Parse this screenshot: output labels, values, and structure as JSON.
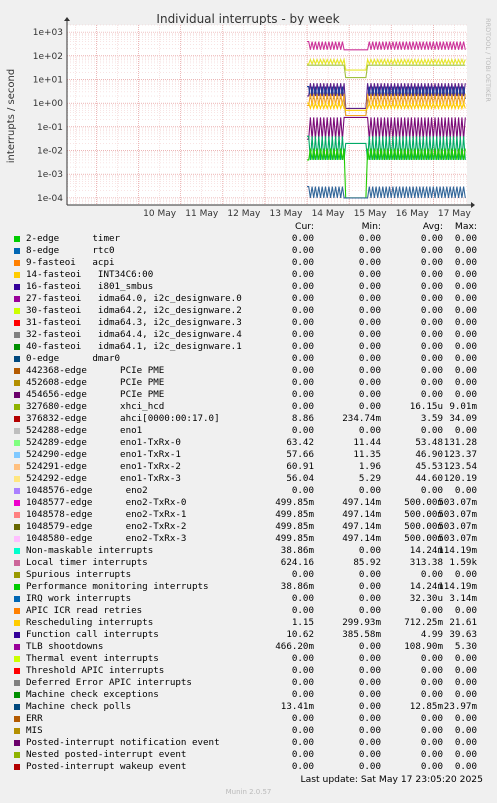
{
  "chart_data": {
    "type": "line",
    "title": "Individual interrupts - by week",
    "ylabel": "interrupts / second",
    "side_label": "RRDTOOL / TOBI OETIKER",
    "yscale": "log",
    "ylim": [
      5e-05,
      2000
    ],
    "y_ticks": [
      {
        "v": 1000,
        "label": "1e+03"
      },
      {
        "v": 100,
        "label": "1e+02"
      },
      {
        "v": 10,
        "label": "1e+01"
      },
      {
        "v": 1,
        "label": "1e+00"
      },
      {
        "v": 0.1,
        "label": "1e-01"
      },
      {
        "v": 0.01,
        "label": "1e-02"
      },
      {
        "v": 0.001,
        "label": "1e-03"
      },
      {
        "v": 0.0001,
        "label": "1e-04"
      }
    ],
    "x_ticks": [
      "10 May",
      "11 May",
      "12 May",
      "13 May",
      "14 May",
      "15 May",
      "16 May",
      "17 May"
    ],
    "x_range_days": [
      8.3,
      17.8
    ],
    "data_start_day": 14.0,
    "gap": [
      14.9,
      15.4
    ],
    "series_levels": [
      {
        "color": "#cc3399",
        "high": 400,
        "low": 180,
        "gap": 180
      },
      {
        "color": "#e6e62a",
        "high": 70,
        "low": 45,
        "gap": 25
      },
      {
        "color": "#a0c040",
        "high": 40,
        "low": 40,
        "gap": 12
      },
      {
        "color": "#5c1f8a",
        "high": 7,
        "low": 2,
        "gap": 0.6
      },
      {
        "color": "#1a3d99",
        "high": 5,
        "low": 1.5,
        "gap": 0.3
      },
      {
        "color": "#f5a623",
        "high": 2.5,
        "low": 0.8,
        "gap": 0.3
      },
      {
        "color": "#ffcc00",
        "high": 1.0,
        "low": 0.6,
        "gap": 0.5
      },
      {
        "color": "#7a0a78",
        "high": 0.25,
        "low": 0.03,
        "gap": 0.25
      },
      {
        "color": "#00aa66",
        "high": 0.04,
        "low": 0.004,
        "gap": 0.02
      },
      {
        "color": "#22cc00",
        "high": 0.012,
        "low": 0.004,
        "gap": 0.0001
      },
      {
        "color": "#336699",
        "high": 0.0003,
        "low": 0.0001,
        "gap": 0.0001
      }
    ],
    "columns": [
      "Cur:",
      "Min:",
      "Avg:",
      "Max:"
    ],
    "legend": [
      {
        "name": "2-edge      timer",
        "color": "#00cc00",
        "cur": "0.00",
        "min": "0.00",
        "avg": "0.00",
        "max": "0.00"
      },
      {
        "name": "8-edge      rtc0",
        "color": "#0066b3",
        "cur": "0.00",
        "min": "0.00",
        "avg": "0.00",
        "max": "0.00"
      },
      {
        "name": "9-fasteoi   acpi",
        "color": "#ff8000",
        "cur": "0.00",
        "min": "0.00",
        "avg": "0.00",
        "max": "0.00"
      },
      {
        "name": "14-fasteoi   INT34C6:00",
        "color": "#ffcc00",
        "cur": "0.00",
        "min": "0.00",
        "avg": "0.00",
        "max": "0.00"
      },
      {
        "name": "16-fasteoi   i801_smbus",
        "color": "#330099",
        "cur": "0.00",
        "min": "0.00",
        "avg": "0.00",
        "max": "0.00"
      },
      {
        "name": "27-fasteoi   idma64.0, i2c_designware.0",
        "color": "#990099",
        "cur": "0.00",
        "min": "0.00",
        "avg": "0.00",
        "max": "0.00"
      },
      {
        "name": "30-fasteoi   idma64.2, i2c_designware.2",
        "color": "#ccff00",
        "cur": "0.00",
        "min": "0.00",
        "avg": "0.00",
        "max": "0.00"
      },
      {
        "name": "31-fasteoi   idma64.3, i2c_designware.3",
        "color": "#ff0000",
        "cur": "0.00",
        "min": "0.00",
        "avg": "0.00",
        "max": "0.00"
      },
      {
        "name": "32-fasteoi   idma64.4, i2c_designware.4",
        "color": "#808080",
        "cur": "0.00",
        "min": "0.00",
        "avg": "0.00",
        "max": "0.00"
      },
      {
        "name": "40-fasteoi   idma64.1, i2c_designware.1",
        "color": "#008f00",
        "cur": "0.00",
        "min": "0.00",
        "avg": "0.00",
        "max": "0.00"
      },
      {
        "name": "0-edge      dmar0",
        "color": "#00487d",
        "cur": "0.00",
        "min": "0.00",
        "avg": "0.00",
        "max": "0.00"
      },
      {
        "name": "442368-edge      PCIe PME",
        "color": "#b35a00",
        "cur": "0.00",
        "min": "0.00",
        "avg": "0.00",
        "max": "0.00"
      },
      {
        "name": "452608-edge      PCIe PME",
        "color": "#b38f00",
        "cur": "0.00",
        "min": "0.00",
        "avg": "0.00",
        "max": "0.00"
      },
      {
        "name": "454656-edge      PCIe PME",
        "color": "#6b006b",
        "cur": "0.00",
        "min": "0.00",
        "avg": "0.00",
        "max": "0.00"
      },
      {
        "name": "327680-edge      xhci_hcd",
        "color": "#8fb300",
        "cur": "0.00",
        "min": "0.00",
        "avg": "16.15u",
        "max": "9.01m"
      },
      {
        "name": "376832-edge      ahci[0000:00:17.0]",
        "color": "#b30000",
        "cur": "8.86",
        "min": "234.74m",
        "avg": "3.59",
        "max": "34.09"
      },
      {
        "name": "524288-edge      eno1",
        "color": "#bebebe",
        "cur": "0.00",
        "min": "0.00",
        "avg": "0.00",
        "max": "0.00"
      },
      {
        "name": "524289-edge      eno1-TxRx-0",
        "color": "#80ff80",
        "cur": "63.42",
        "min": "11.44",
        "avg": "53.48",
        "max": "131.28"
      },
      {
        "name": "524290-edge      eno1-TxRx-1",
        "color": "#80c9ff",
        "cur": "57.66",
        "min": "11.35",
        "avg": "46.90",
        "max": "123.37"
      },
      {
        "name": "524291-edge      eno1-TxRx-2",
        "color": "#ffc080",
        "cur": "60.91",
        "min": "1.96",
        "avg": "45.53",
        "max": "123.54"
      },
      {
        "name": "524292-edge      eno1-TxRx-3",
        "color": "#ffe680",
        "cur": "56.04",
        "min": "5.29",
        "avg": "44.60",
        "max": "120.19"
      },
      {
        "name": "1048576-edge      eno2",
        "color": "#aa80ff",
        "cur": "0.00",
        "min": "0.00",
        "avg": "0.00",
        "max": "0.00"
      },
      {
        "name": "1048577-edge      eno2-TxRx-0",
        "color": "#ee00cc",
        "cur": "499.85m",
        "min": "497.14m",
        "avg": "500.00m",
        "max": "503.07m"
      },
      {
        "name": "1048578-edge      eno2-TxRx-1",
        "color": "#ff8080",
        "cur": "499.85m",
        "min": "497.14m",
        "avg": "500.00m",
        "max": "503.07m"
      },
      {
        "name": "1048579-edge      eno2-TxRx-2",
        "color": "#666600",
        "cur": "499.85m",
        "min": "497.14m",
        "avg": "500.00m",
        "max": "503.07m"
      },
      {
        "name": "1048580-edge      eno2-TxRx-3",
        "color": "#ffbfff",
        "cur": "499.85m",
        "min": "497.14m",
        "avg": "500.00m",
        "max": "503.07m"
      },
      {
        "name": "Non-maskable interrupts",
        "color": "#00ffcc",
        "cur": "38.86m",
        "min": "0.00",
        "avg": "14.24m",
        "max": "114.19m"
      },
      {
        "name": "Local timer interrupts",
        "color": "#cc6699",
        "cur": "624.16",
        "min": "85.92",
        "avg": "313.38",
        "max": "1.59k"
      },
      {
        "name": "Spurious interrupts",
        "color": "#999900",
        "cur": "0.00",
        "min": "0.00",
        "avg": "0.00",
        "max": "0.00"
      },
      {
        "name": "Performance monitoring interrupts",
        "color": "#00cc00",
        "cur": "38.86m",
        "min": "0.00",
        "avg": "14.24m",
        "max": "114.19m"
      },
      {
        "name": "IRQ work interrupts",
        "color": "#0066b3",
        "cur": "0.00",
        "min": "0.00",
        "avg": "32.30u",
        "max": "3.14m"
      },
      {
        "name": "APIC ICR read retries",
        "color": "#ff8000",
        "cur": "0.00",
        "min": "0.00",
        "avg": "0.00",
        "max": "0.00"
      },
      {
        "name": "Rescheduling interrupts",
        "color": "#ffcc00",
        "cur": "1.15",
        "min": "299.93m",
        "avg": "712.25m",
        "max": "21.61"
      },
      {
        "name": "Function call interrupts",
        "color": "#330099",
        "cur": "10.62",
        "min": "385.58m",
        "avg": "4.99",
        "max": "39.63"
      },
      {
        "name": "TLB shootdowns",
        "color": "#990099",
        "cur": "466.20m",
        "min": "0.00",
        "avg": "108.90m",
        "max": "5.30"
      },
      {
        "name": "Thermal event interrupts",
        "color": "#ccff00",
        "cur": "0.00",
        "min": "0.00",
        "avg": "0.00",
        "max": "0.00"
      },
      {
        "name": "Threshold APIC interrupts",
        "color": "#ff0000",
        "cur": "0.00",
        "min": "0.00",
        "avg": "0.00",
        "max": "0.00"
      },
      {
        "name": "Deferred Error APIC interrupts",
        "color": "#808080",
        "cur": "0.00",
        "min": "0.00",
        "avg": "0.00",
        "max": "0.00"
      },
      {
        "name": "Machine check exceptions",
        "color": "#008f00",
        "cur": "0.00",
        "min": "0.00",
        "avg": "0.00",
        "max": "0.00"
      },
      {
        "name": "Machine check polls",
        "color": "#00487d",
        "cur": "13.41m",
        "min": "0.00",
        "avg": "12.85m",
        "max": "23.97m"
      },
      {
        "name": "ERR",
        "color": "#b35a00",
        "cur": "0.00",
        "min": "0.00",
        "avg": "0.00",
        "max": "0.00"
      },
      {
        "name": "MIS",
        "color": "#b38f00",
        "cur": "0.00",
        "min": "0.00",
        "avg": "0.00",
        "max": "0.00"
      },
      {
        "name": "Posted-interrupt notification event",
        "color": "#6b006b",
        "cur": "0.00",
        "min": "0.00",
        "avg": "0.00",
        "max": "0.00"
      },
      {
        "name": "Nested posted-interrupt event",
        "color": "#8fb300",
        "cur": "0.00",
        "min": "0.00",
        "avg": "0.00",
        "max": "0.00"
      },
      {
        "name": "Posted-interrupt wakeup event",
        "color": "#b30000",
        "cur": "0.00",
        "min": "0.00",
        "avg": "0.00",
        "max": "0.00"
      }
    ],
    "last_update": "Last update: Sat May 17 23:05:20 2025",
    "footer": "Munin 2.0.57"
  }
}
